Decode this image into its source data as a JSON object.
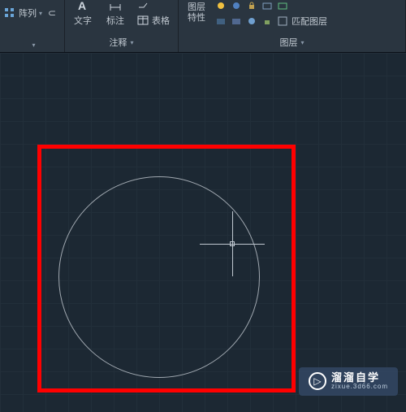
{
  "ribbon": {
    "panel1": {
      "item1": "阵列",
      "title": ""
    },
    "panel2": {
      "text": "文字",
      "dim": "标注",
      "table": "表格",
      "title": "注释"
    },
    "panel3": {
      "layerprops": "图层\n特性",
      "match": "匹配图层",
      "title": "图层"
    }
  },
  "watermark": {
    "main": "溜溜自学",
    "sub": "zixue.3d66.com"
  },
  "colors": {
    "highlight": "#ff0000",
    "canvas_bg": "#1c2833",
    "ribbon_bg": "#2a3540"
  }
}
